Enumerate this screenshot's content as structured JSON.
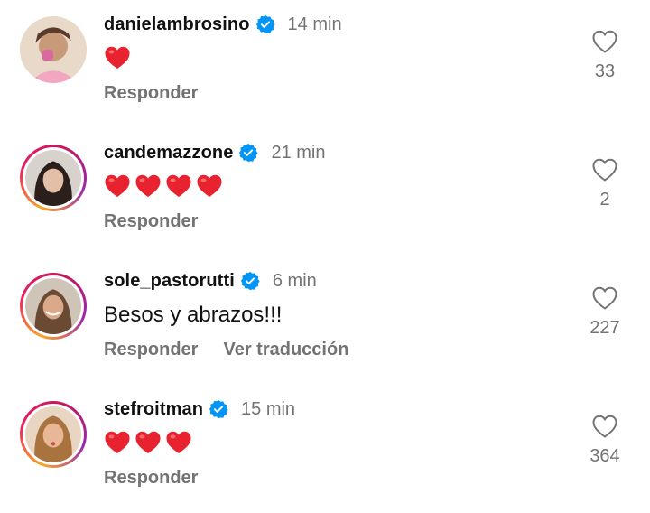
{
  "colors": {
    "heart": "#e8232f",
    "verified": "#0095f6",
    "muted": "#737373"
  },
  "comments": [
    {
      "username": "danielambrosino",
      "time": "14 min",
      "hearts": 1,
      "text": "",
      "reply": "Responder",
      "translate": "",
      "likes": "33",
      "ring": false
    },
    {
      "username": "candemazzone",
      "time": "21 min",
      "hearts": 4,
      "text": "",
      "reply": "Responder",
      "translate": "",
      "likes": "2",
      "ring": true
    },
    {
      "username": "sole_pastorutti",
      "time": "6 min",
      "hearts": 0,
      "text": "Besos y abrazos!!!",
      "reply": "Responder",
      "translate": "Ver traducción",
      "likes": "227",
      "ring": true
    },
    {
      "username": "stefroitman",
      "time": "15 min",
      "hearts": 3,
      "text": "",
      "reply": "Responder",
      "translate": "",
      "likes": "364",
      "ring": true
    }
  ]
}
